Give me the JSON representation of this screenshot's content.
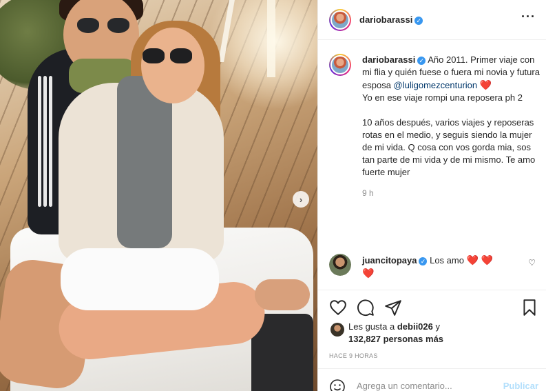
{
  "post": {
    "author": "dariobarassi",
    "more_icon": "more-horizontal-icon",
    "verified_icon": "verified-badge-icon"
  },
  "caption": {
    "username": "dariobarassi",
    "text_1": "Año 2011. Primer viaje con mi flia y quién fuese o fuera mi novia y futura esposa",
    "mention": "@luligomezcenturion",
    "heart": "❤️",
    "text_2": "Yo en ese viaje rompi una reposera ph 2",
    "text_3": "10 años después, varios viajes y reposeras rotas en el medio, y seguis siendo la mujer de mi vida. Q cosa con vos gorda mia, sos tan parte de mi vida y de mi mismo. Te amo fuerte mujer",
    "time": "9 h"
  },
  "comment": {
    "username": "juancitopaya",
    "text": "Los amo",
    "hearts": "❤️ ❤️",
    "heart_2": "❤️"
  },
  "actions": {
    "like_icon": "heart-outline-icon",
    "comment_icon": "comment-icon",
    "share_icon": "paper-plane-icon",
    "save_icon": "bookmark-icon"
  },
  "likes": {
    "prefix": "Les gusta a",
    "user": "debii026",
    "connector": "y",
    "count": "132,827 personas más"
  },
  "timestamp": "HACE 9 HORAS",
  "composer": {
    "placeholder": "Agrega un comentario...",
    "publish": "Publicar",
    "emoji_icon": "smiley-icon"
  },
  "colors": {
    "link": "#00376b",
    "verified": "#3897f0",
    "heart": "#ed4956",
    "publish_disabled": "#b2dffc",
    "muted": "#8e8e8e"
  }
}
